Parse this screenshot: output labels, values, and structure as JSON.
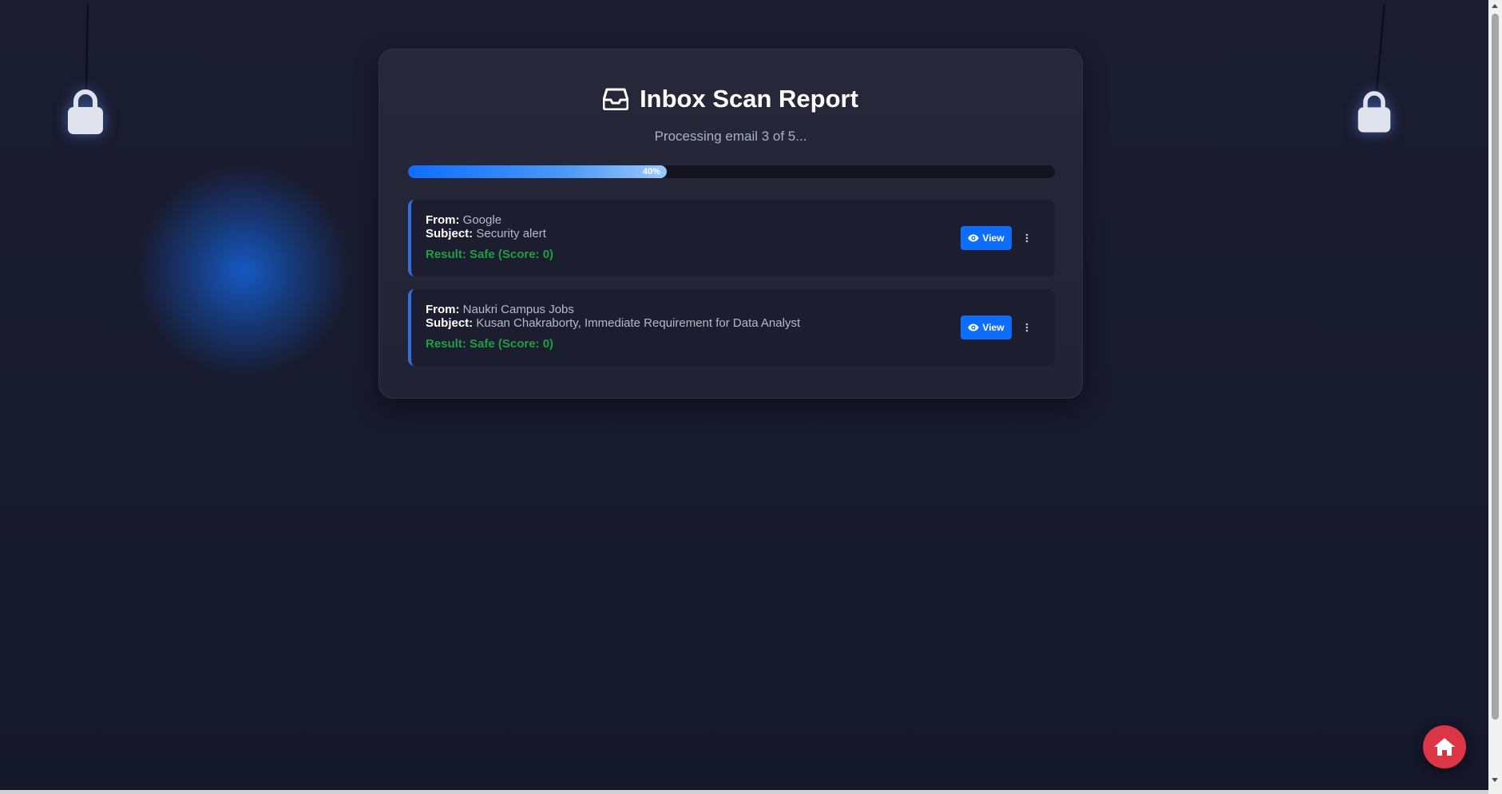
{
  "page": {
    "title": "Inbox Scan Report",
    "status": "Processing email 3 of 5...",
    "progress": {
      "percent": 40,
      "label": "40%"
    }
  },
  "emails": [
    {
      "from_label": "From:",
      "from": "Google",
      "subject_label": "Subject:",
      "subject": "Security alert",
      "result": "Result: Safe (Score: 0)",
      "view_label": "View"
    },
    {
      "from_label": "From:",
      "from": "Naukri Campus Jobs",
      "subject_label": "Subject:",
      "subject": "Kusan Chakraborty, Immediate Requirement for Data Analyst",
      "result": "Result: Safe (Score: 0)",
      "view_label": "View"
    }
  ],
  "icons": {
    "title": "inbox-icon",
    "view": "eye-icon",
    "more": "kebab-menu-icon",
    "home": "home-icon",
    "decor": "padlock-icon"
  },
  "colors": {
    "background": "#181a2c",
    "card": "#242637",
    "accent": "#0d6efd",
    "safe": "#1e9e45",
    "home_button": "#dc3545"
  }
}
